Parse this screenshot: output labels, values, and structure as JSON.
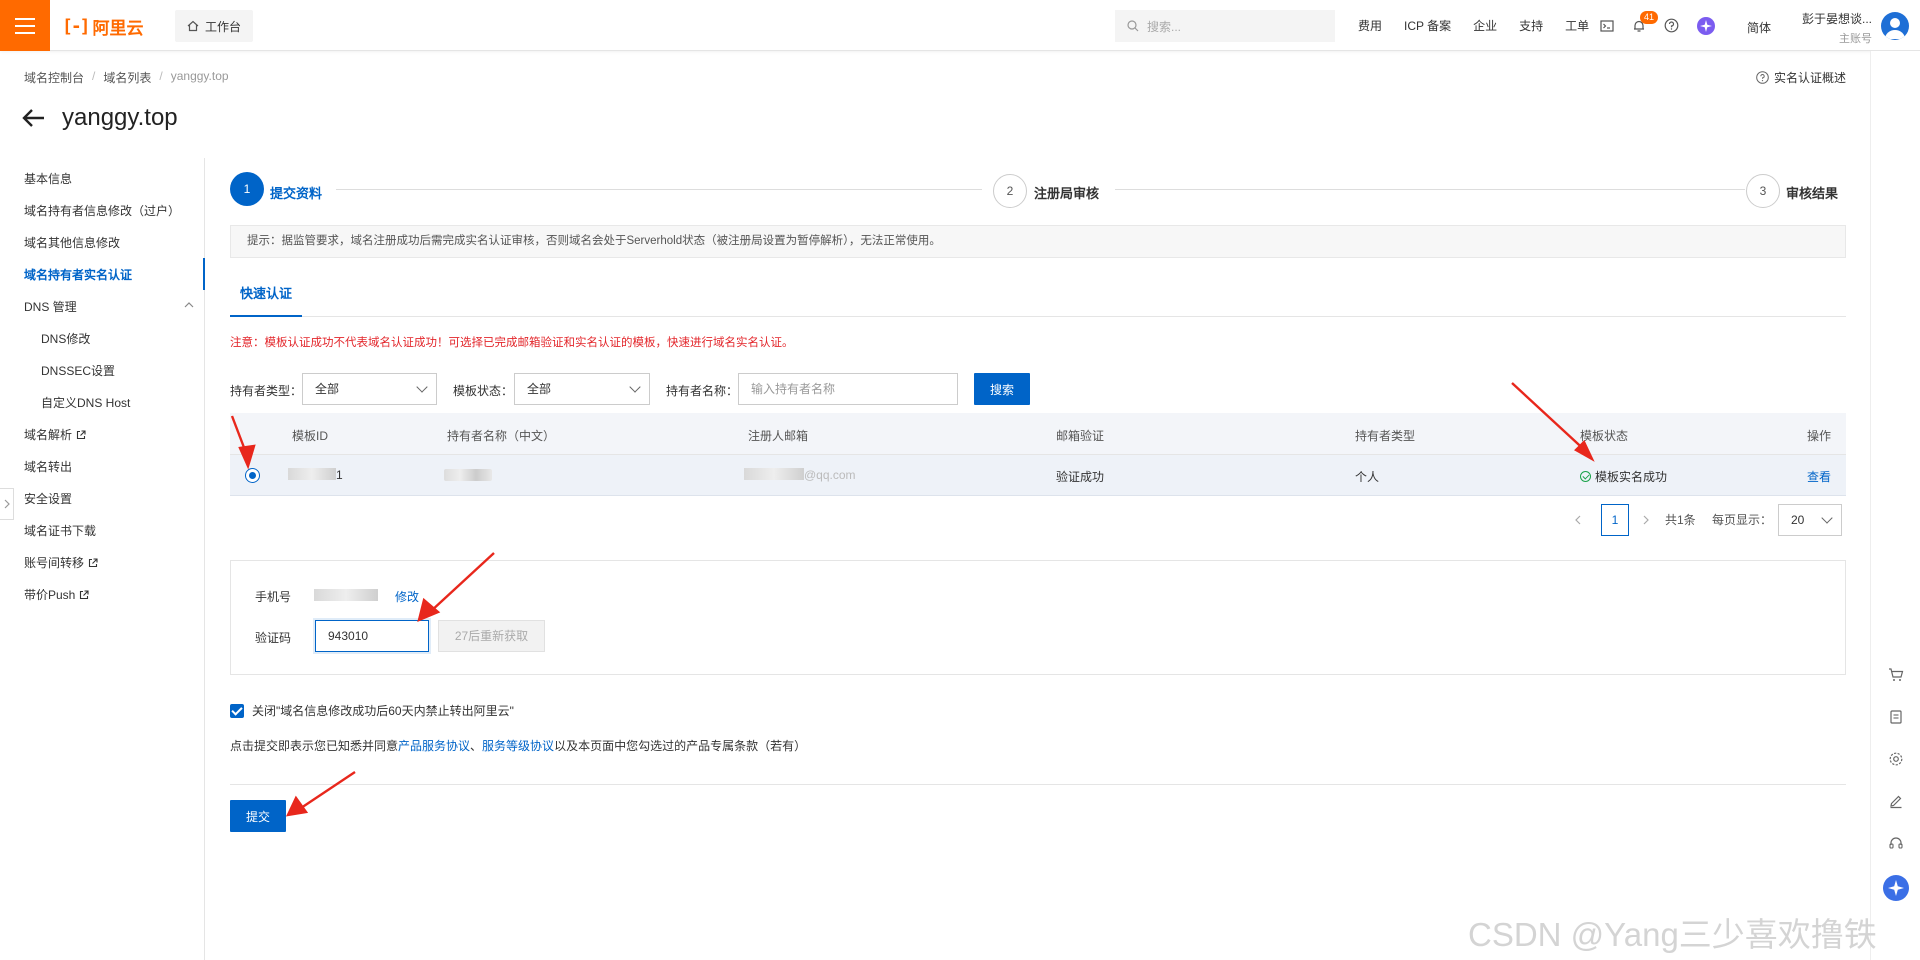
{
  "topbar": {
    "brand": "阿里云",
    "workbench": "工作台",
    "search_placeholder": "搜索...",
    "links": [
      "费用",
      "ICP 备案",
      "企业",
      "支持",
      "工单"
    ],
    "notification_count": "41",
    "lang": "简体",
    "user_name": "彭于晏想谈...",
    "user_sub": "主账号"
  },
  "breadcrumb": {
    "items": [
      "域名控制台",
      "域名列表"
    ],
    "current": "yanggy.top"
  },
  "help_link": "实名认证概述",
  "page_title": "yanggy.top",
  "nav": {
    "items": [
      "基本信息",
      "域名持有者信息修改（过户）",
      "域名其他信息修改",
      "域名持有者实名认证",
      "DNS 管理",
      "DNS修改",
      "DNSSEC设置",
      "自定义DNS Host",
      "域名解析",
      "域名转出",
      "安全设置",
      "域名证书下载",
      "账号间转移",
      "带价Push"
    ]
  },
  "steps": [
    {
      "num": "1",
      "label": "提交资料"
    },
    {
      "num": "2",
      "label": "注册局审核"
    },
    {
      "num": "3",
      "label": "审核结果"
    }
  ],
  "notice": "提示：据监管要求，域名注册成功后需完成实名认证审核，否则域名会处于Serverhold状态（被注册局设置为暂停解析），无法正常使用。",
  "tab": "快速认证",
  "warning": "注意：模板认证成功不代表域名认证成功！可选择已完成邮箱验证和实名认证的模板，快速进行域名实名认证。",
  "filters": {
    "holder_type_label": "持有者类型：",
    "holder_type_value": "全部",
    "template_status_label": "模板状态：",
    "template_status_value": "全部",
    "holder_name_label": "持有者名称：",
    "holder_name_placeholder": "输入持有者名称",
    "search_button": "搜索"
  },
  "table": {
    "headers": [
      "模板ID",
      "持有者名称（中文）",
      "注册人邮箱",
      "邮箱验证",
      "持有者类型",
      "模板状态",
      "操作"
    ],
    "row": {
      "template_id": "1",
      "holder_name": "",
      "email": "@qq.com",
      "email_verify": "验证成功",
      "holder_type": "个人",
      "template_status": "模板实名成功",
      "action": "查看"
    }
  },
  "pagination": {
    "current": "1",
    "total": "共1条",
    "page_size_label": "每页显示：",
    "page_size": "20"
  },
  "verify": {
    "phone_label": "手机号",
    "modify_link": "修改",
    "code_label": "验证码",
    "code_value": "943010",
    "resend_button": "27后重新获取"
  },
  "checkbox_label": "关闭\"域名信息修改成功后60天内禁止转出阿里云\"",
  "agreement": {
    "prefix": "点击提交即表示您已知悉并同意",
    "link1": "产品服务协议",
    "sep": "、",
    "link2": "服务等级协议",
    "suffix": "以及本页面中您勾选过的产品专属条款（若有）"
  },
  "submit_button": "提交",
  "watermark": "CSDN @Yang三少喜欢撸铁",
  "colors": {
    "brand": "#ff6a00",
    "primary": "#0064c8",
    "warning": "#e3262b",
    "success": "#1aa34a"
  }
}
